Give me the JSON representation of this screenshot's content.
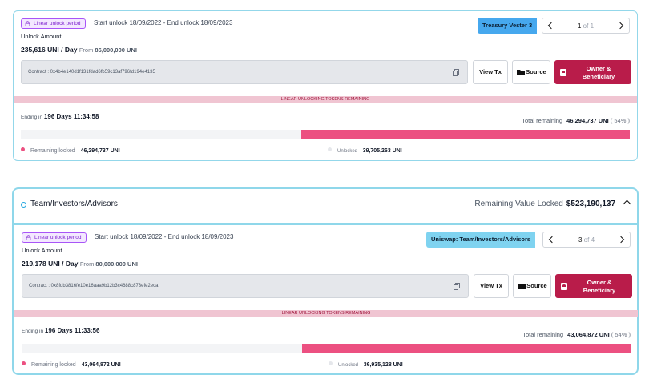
{
  "vesting_cards": [
    {
      "badge": "Linear unlock period",
      "period": "Start unlock 18/09/2022 - End unlock 18/09/2023",
      "unlock_amount_label": "Unlock Amount",
      "rate_value": "235,616 UNI",
      "rate_unit": "/ Day",
      "rate_from_label": "From",
      "rate_from_value": "86,000,000 UNI",
      "vester_name": "Treasury Vester 3",
      "page_current": "1",
      "page_of": "of 1",
      "contract": "Contract : 0x4b4e140d1f131fdad6fb59c13af796fd194e4135",
      "view_tx": "View Tx",
      "source": "Source",
      "owner_line1": "Owner &",
      "owner_line2": "Beneficiary",
      "banner": "LINEAR UNLOCKING TOKENS REMAINING",
      "ending_label": "Ending in",
      "ending_value": "196 Days 11:34:58",
      "total_label": "Total remaining",
      "total_value": "46,294,737 UNI",
      "total_pct": "( 54% )",
      "remaining_fraction": 0.54,
      "locked_label": "Remaining locked",
      "locked_value": "46,294,737 UNI",
      "unlocked_label": "Unlocked",
      "unlocked_value": "39,705,263 UNI"
    },
    {
      "badge": "Linear unlock period",
      "period": "Start unlock 18/09/2022 - End unlock 18/09/2023",
      "unlock_amount_label": "Unlock Amount",
      "rate_value": "219,178 UNI",
      "rate_unit": "/ Day",
      "rate_from_label": "From",
      "rate_from_value": "80,000,000 UNI",
      "vester_name": "Uniswap: Team/Investors/Advisors",
      "page_current": "3",
      "page_of": "of 4",
      "contract": "Contract : 0x8fdb3816fe10e16aaa9b12b3c4688c873efe2eca",
      "view_tx": "View Tx",
      "source": "Source",
      "owner_line1": "Owner &",
      "owner_line2": "Beneficiary",
      "banner": "LINEAR UNLOCKING TOKENS REMAINING",
      "ending_label": "Ending in",
      "ending_value": "196 Days 11:33:56",
      "total_label": "Total remaining",
      "total_value": "43,064,872 UNI",
      "total_pct": "( 54% )",
      "remaining_fraction": 0.54,
      "locked_label": "Remaining locked",
      "locked_value": "43,064,872 UNI",
      "unlocked_label": "Unlocked",
      "unlocked_value": "36,935,128 UNI"
    }
  ],
  "group": {
    "title": "Team/Investors/Advisors",
    "locked_label": "Remaining Value Locked",
    "locked_value": "$523,190,137"
  },
  "colors": {
    "accent_pink": "#ec5081",
    "owner_button": "#b91c4a",
    "vester_blue_1": "#46a8ee",
    "vester_blue_2": "#7fd3f0",
    "card_border": "#8fd7ea"
  },
  "icons": [
    "lock-icon",
    "copy-icon",
    "folder-icon",
    "owner-icon",
    "chevron-left-icon",
    "chevron-right-icon",
    "chevron-up-icon"
  ]
}
